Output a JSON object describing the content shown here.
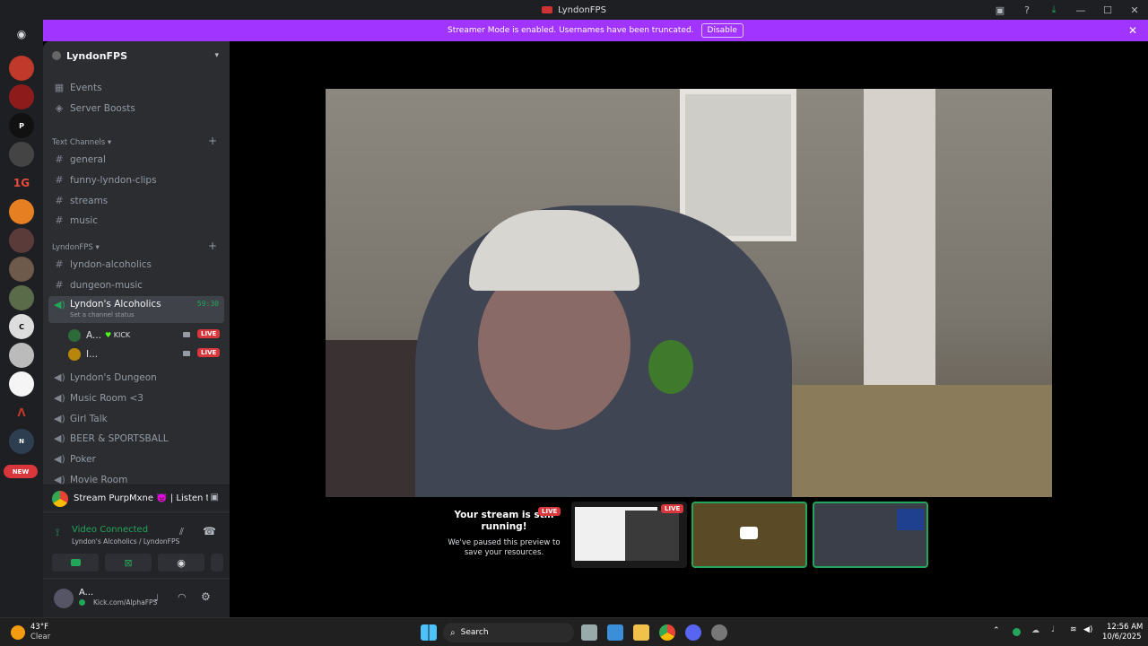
{
  "window": {
    "title": "LyndonFPS"
  },
  "banner": {
    "text": "Streamer Mode is enabled. Usernames have been truncated.",
    "button": "Disable"
  },
  "rail": {
    "new_badge": "NEW"
  },
  "sidebar": {
    "server_name": "LyndonFPS",
    "top_items": [
      {
        "label": "Events",
        "icon": "calendar-icon"
      },
      {
        "label": "Server Boosts",
        "icon": "boost-icon"
      }
    ],
    "text_category": "Text Channels",
    "text_channels": [
      "general",
      "funny-lyndon-clips",
      "streams",
      "music"
    ],
    "lyndon_category": "LyndonFPS",
    "lyndon_channels": [
      "lyndon-alcoholics",
      "dungeon-music"
    ],
    "active_voice": {
      "label": "Lyndon's Alcoholics",
      "timer": "59:30",
      "status": "Set a channel status"
    },
    "voice_users": [
      {
        "name": "A...",
        "tag": "KICK",
        "live": "LIVE"
      },
      {
        "name": "I...",
        "live": "LIVE"
      }
    ],
    "voice_channels": [
      "Lyndon's Dungeon",
      "Music Room <3",
      "Girl Talk",
      "BEER & SPORTSBALL",
      "Poker",
      "Movie Room"
    ]
  },
  "activity": {
    "text": "Stream PurpMxne 👿 | Listen to ..."
  },
  "connection": {
    "status": "Video Connected",
    "channel": "Lyndon's Alcoholics / LyndonFPS"
  },
  "user": {
    "name": "A...",
    "status": "Kick.com/AlphaFPS"
  },
  "stage": {
    "paused_title": "Your stream is still running!",
    "paused_body": "We've paused this preview to save your resources.",
    "live": "LIVE"
  },
  "taskbar": {
    "temp": "43°F",
    "weather": "Clear",
    "search": "Search",
    "time": "12:56 AM",
    "date": "10/6/2025"
  },
  "colors": {
    "accent": "#a135ff",
    "live": "#da373c",
    "connected": "#23a55a"
  }
}
